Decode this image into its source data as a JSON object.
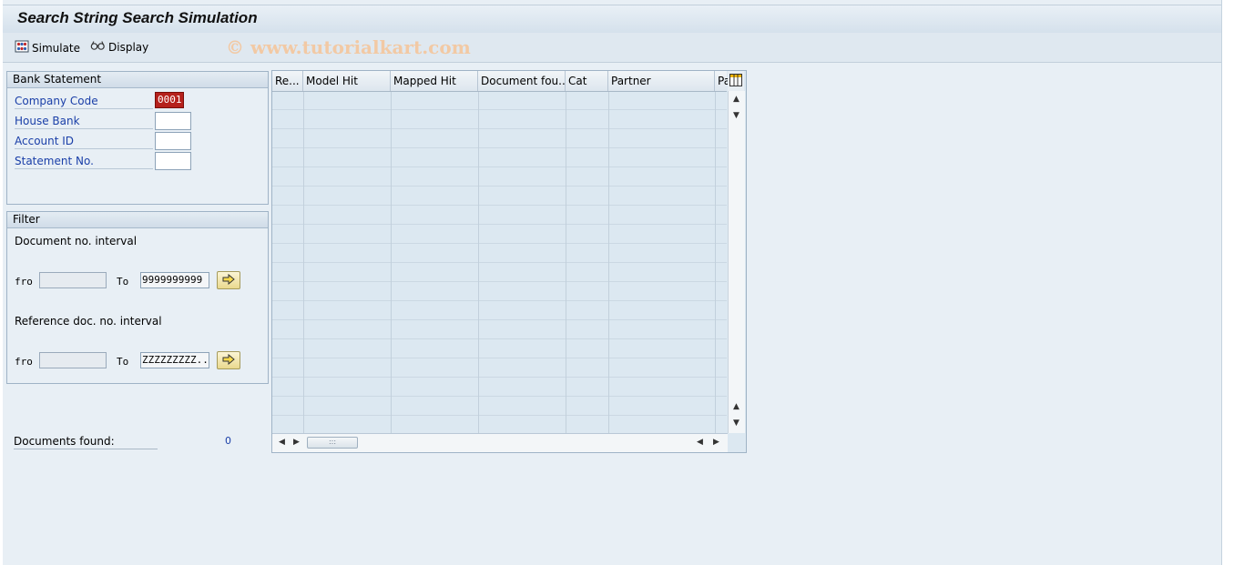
{
  "window": {
    "title": "Search String Search Simulation"
  },
  "toolbar": {
    "simulate_label": "Simulate",
    "display_label": "Display"
  },
  "watermark": "© www.tutorialkart.com",
  "bank_statement": {
    "title": "Bank Statement",
    "company_code_label": "Company Code",
    "company_code_value": "0001",
    "house_bank_label": "House Bank",
    "account_id_label": "Account ID",
    "statement_no_label": "Statement No."
  },
  "filter": {
    "title": "Filter",
    "doc_interval_label": "Document no. interval",
    "doc_from_label": "fro",
    "doc_to_label": "To",
    "doc_to_value": "9999999999",
    "ref_interval_label": "Reference doc. no. interval",
    "ref_from_label": "fro",
    "ref_to_label": "To",
    "ref_to_value": "ZZZZZZZZZ..."
  },
  "result": {
    "documents_found_label": "Documents found:",
    "documents_found_value": "0"
  },
  "grid": {
    "columns": [
      "Re...",
      "Model Hit",
      "Mapped Hit",
      "Document fou...",
      "Cat",
      "Partner",
      "Pa"
    ]
  },
  "icons": {
    "simulate": "simulate-icon",
    "display": "glasses-icon",
    "arrow": "multiple-selection-arrow-icon",
    "grid_settings": "layout-settings-icon"
  },
  "colors": {
    "required_field": "#b5211c",
    "label_blue": "#1a3fa8",
    "background": "#e8eff5"
  }
}
